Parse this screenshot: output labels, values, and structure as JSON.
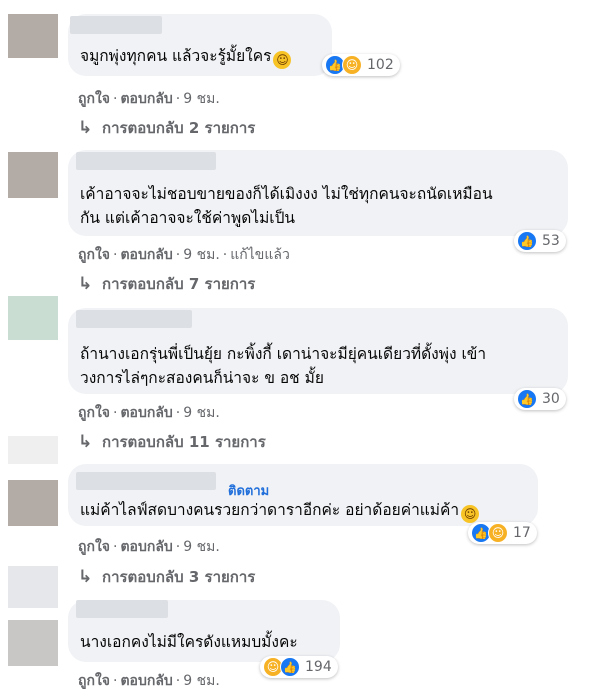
{
  "comments": [
    {
      "text_lines": [
        "จมูกพุ่งทุกคน แล้วจะรู้มั้ยใคร"
      ],
      "has_emoji": true,
      "reactions": {
        "icons": [
          "like-icon",
          "haha-icon"
        ],
        "count": "102"
      },
      "actions": {
        "like": "ถูกใจ",
        "reply": "ตอบกลับ",
        "time": "9 ชม."
      },
      "replies": "การตอบกลับ 2 รายการ"
    },
    {
      "text_lines": [
        "เค้าอาจจะไม่ชอบขายของก็ได้เมิงงง ไม่ใช่ทุกคนจะถนัดเหมือน",
        "กัน แต่เค้าอาจจะใช้ค่าพูดไม่เป็น"
      ],
      "has_emoji": false,
      "reactions": {
        "icons": [
          "like-icon"
        ],
        "count": "53"
      },
      "actions": {
        "like": "ถูกใจ",
        "reply": "ตอบกลับ",
        "time": "9 ชม.",
        "edited": "แก้ไขแล้ว"
      },
      "replies": "การตอบกลับ 7 รายการ"
    },
    {
      "text_lines": [
        "ถ้านางเอกรุ่นพี่เป็นยุ้ย กะพิ้งกี้ เดาน่าจะมียุ่คนเดียวที่ดั้งพุ่ง เข้า",
        "วงการไล่ๆกะสองคนก็น่าจะ ข อช มั้ย"
      ],
      "has_emoji": false,
      "reactions": {
        "icons": [
          "like-icon"
        ],
        "count": "30"
      },
      "actions": {
        "like": "ถูกใจ",
        "reply": "ตอบกลับ",
        "time": "9 ชม."
      },
      "replies": "การตอบกลับ 11 รายการ"
    },
    {
      "follow_label": "ติดตาม",
      "text_lines": [
        "แม่ค้าไลฟ์สดบางคนรวยกว่าดาราอีกค่ะ อย่าด้อยค่าแม่ค้า"
      ],
      "has_emoji": true,
      "reactions": {
        "icons": [
          "like-icon",
          "haha-icon"
        ],
        "count": "17"
      },
      "actions": {
        "like": "ถูกใจ",
        "reply": "ตอบกลับ",
        "time": "9 ชม."
      },
      "replies": "การตอบกลับ 3 รายการ"
    },
    {
      "text_lines": [
        "นางเอกคงไม่มีใครดังแหมบมั้งคะ"
      ],
      "has_emoji": false,
      "reactions": {
        "icons": [
          "haha-icon",
          "like-icon"
        ],
        "count": "194"
      },
      "actions": {
        "like": "ถูกใจ",
        "reply": "ตอบกลับ",
        "time": "9 ชม."
      }
    }
  ],
  "colors": {
    "bubble": "#f0f2f5",
    "meta": "#65676b",
    "link": "#216fdb",
    "like": "#1877f2",
    "haha": "#f7b125"
  }
}
